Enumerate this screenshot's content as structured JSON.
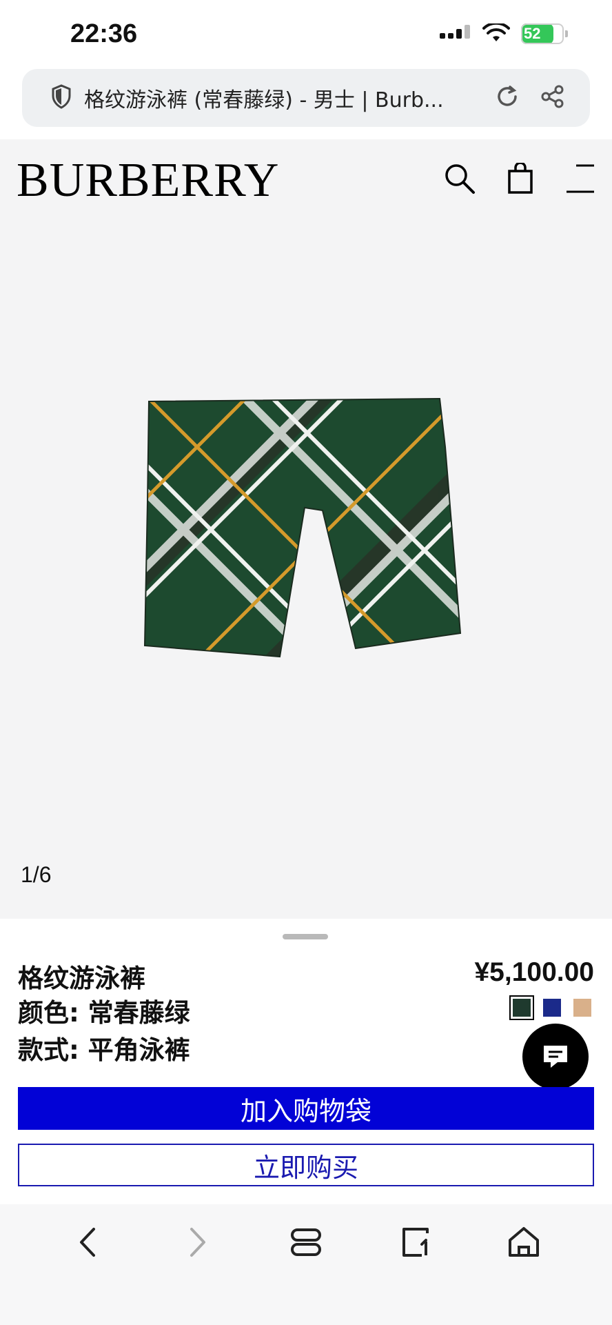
{
  "status": {
    "time": "22:36",
    "battery": "52"
  },
  "browser": {
    "page_title": "格纹游泳裤 (常春藤绿) - 男士 | Burb..."
  },
  "site": {
    "logo": "BURBERRY"
  },
  "gallery": {
    "counter": "1/6"
  },
  "product": {
    "name": "格纹游泳裤",
    "price": "¥5,100.00",
    "color_line": "颜色: 常春藤绿",
    "style_line": "款式: 平角泳裤",
    "swatches": [
      {
        "color": "#1f3a2e",
        "selected": true
      },
      {
        "color": "#1b2a8a",
        "selected": false
      },
      {
        "color": "#d9b08a",
        "selected": false
      }
    ]
  },
  "actions": {
    "add_to_bag": "加入购物袋",
    "buy_now": "立即购买"
  },
  "colors": {
    "accent_blue": "#0202d6",
    "battery_green": "#34c759"
  },
  "icons": [
    "shield-icon",
    "reload-icon",
    "share-icon",
    "search-icon",
    "shopping-bag-icon",
    "menu-icon",
    "chat-icon",
    "back-icon",
    "forward-icon",
    "tabs-icon",
    "bookmark-icon",
    "home-icon"
  ]
}
